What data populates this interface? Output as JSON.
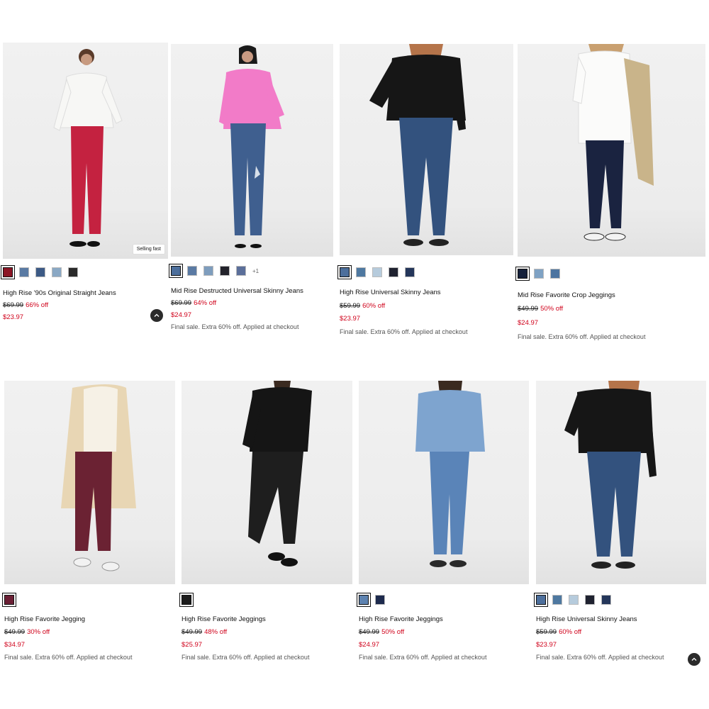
{
  "products": [
    {
      "name": "High Rise '90s Original Straight Jeans",
      "original_price": "$69.99",
      "discount": "66% off",
      "sale_price": "$23.97",
      "promo": "",
      "badge": "Selling fast",
      "swatches": [
        "#8c1626",
        "#5a7aa3",
        "#3c5a85",
        "#8aa8c4",
        "#2a2a2a"
      ],
      "more_swatches": ""
    },
    {
      "name": "Mid Rise Destructed Universal Skinny Jeans",
      "original_price": "$69.99",
      "discount": "64% off",
      "sale_price": "$24.97",
      "promo": "Final sale. Extra 60% off. Applied at checkout",
      "badge": "",
      "swatches": [
        "#4d6f9c",
        "#5a7aa3",
        "#7e9dbd",
        "#23232b",
        "#5b6f9a"
      ],
      "more_swatches": "+1"
    },
    {
      "name": "High Rise Universal Skinny Jeans",
      "original_price": "$59.99",
      "discount": "60% off",
      "sale_price": "$23.97",
      "promo": "Final sale. Extra 60% off. Applied at checkout",
      "badge": "",
      "swatches": [
        "#4d6f9c",
        "#4e78a0",
        "#b6cbdc",
        "#1f2230",
        "#24365a"
      ],
      "more_swatches": ""
    },
    {
      "name": "Mid Rise Favorite Crop Jeggings",
      "original_price": "$49.99",
      "discount": "50% off",
      "sale_price": "$24.97",
      "promo": "Final sale. Extra 60% off. Applied at checkout",
      "badge": "",
      "swatches": [
        "#15203a",
        "#7fa2c4",
        "#4c74a0"
      ],
      "more_swatches": ""
    },
    {
      "name": "High Rise Favorite Jegging",
      "original_price": "$49.99",
      "discount": "30% off",
      "sale_price": "$34.97",
      "promo": "Final sale. Extra 60% off. Applied at checkout",
      "badge": "",
      "swatches": [
        "#6b1f35"
      ],
      "more_swatches": ""
    },
    {
      "name": "High Rise Favorite Jeggings",
      "original_price": "$49.99",
      "discount": "48% off",
      "sale_price": "$25.97",
      "promo": "Final sale. Extra 60% off. Applied at checkout",
      "badge": "",
      "swatches": [
        "#1c1c1c"
      ],
      "more_swatches": ""
    },
    {
      "name": "High Rise Favorite Jeggings",
      "original_price": "$49.99",
      "discount": "50% off",
      "sale_price": "$24.97",
      "promo": "Final sale. Extra 60% off. Applied at checkout",
      "badge": "",
      "swatches": [
        "#5d82b0",
        "#1d2a4d"
      ],
      "more_swatches": ""
    },
    {
      "name": "High Rise Universal Skinny Jeans",
      "original_price": "$59.99",
      "discount": "60% off",
      "sale_price": "$23.97",
      "promo": "Final sale. Extra 60% off. Applied at checkout",
      "badge": "",
      "swatches": [
        "#4d6f9c",
        "#4e78a0",
        "#b6cbdc",
        "#1f2230",
        "#24365a"
      ],
      "more_swatches": ""
    }
  ],
  "scroll_buttons": {
    "icon": "chevron-up-icon"
  },
  "colors": {
    "sale": "#d0021b",
    "text": "#111111",
    "promo": "#555555"
  }
}
